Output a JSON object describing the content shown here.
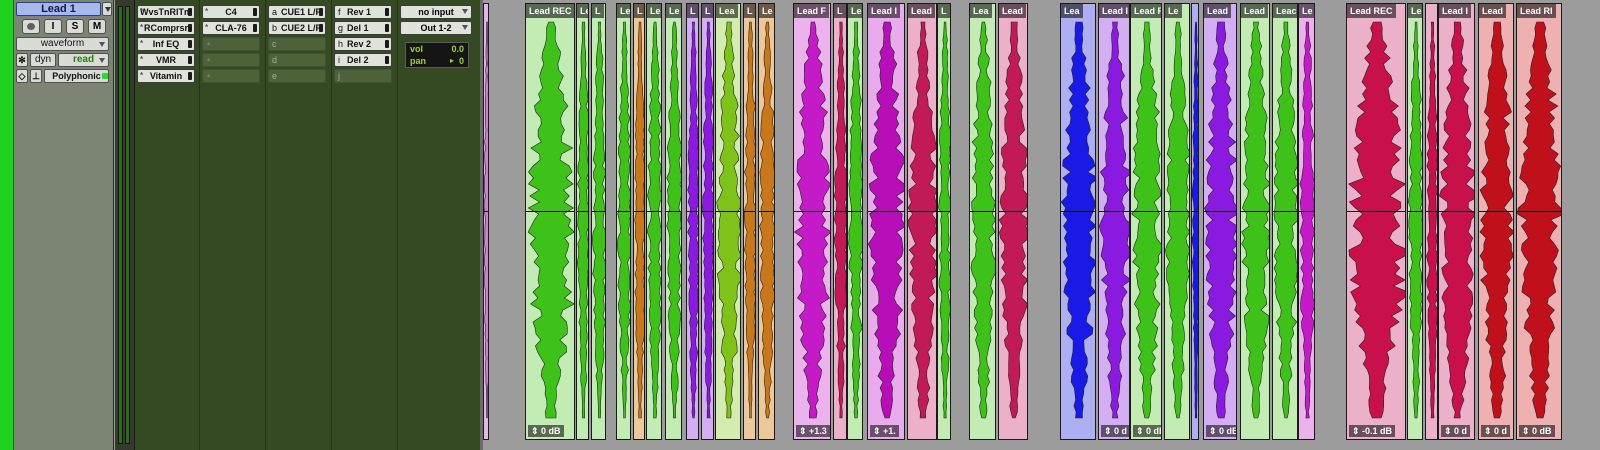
{
  "track": {
    "name": "Lead 1",
    "record_label": "",
    "input_monitor_label": "I",
    "solo_label": "S",
    "mute_label": "M",
    "view": "waveform",
    "dyn_label": "dyn",
    "automation_mode": "read",
    "elastic_audio": "Polyphonic",
    "color": "#1fd21f"
  },
  "inserts_a_e": [
    "WvsTnRlTm",
    "RComprsr",
    "Inf EQ",
    "VMR",
    "Vitamin"
  ],
  "inserts_f_j": [
    "C4",
    "CLA-76",
    "",
    "",
    ""
  ],
  "sends_a_e": [
    {
      "letter": "a",
      "name": "CUE1 L/R"
    },
    {
      "letter": "b",
      "name": "CUE2 L/R"
    },
    {
      "letter": "c",
      "name": ""
    },
    {
      "letter": "d",
      "name": ""
    },
    {
      "letter": "e",
      "name": ""
    }
  ],
  "sends_f_j": [
    {
      "letter": "f",
      "name": "Rev 1"
    },
    {
      "letter": "g",
      "name": "Del 1"
    },
    {
      "letter": "h",
      "name": "Rev 2"
    },
    {
      "letter": "i",
      "name": "Del 2"
    },
    {
      "letter": "j",
      "name": ""
    }
  ],
  "io": {
    "input": "no input",
    "output": "Out 1-2",
    "vol_label": "vol",
    "vol_value": "0.0",
    "pan_label": "pan",
    "pan_value": "0"
  },
  "clips": [
    {
      "label": "",
      "gain": "",
      "color": "#d080d0",
      "bg": "#e3b7e3"
    },
    {
      "label": "Lead REC",
      "gain": "0 dB",
      "color": "#3ec21a",
      "bg": "#c2ecb4"
    },
    {
      "label": "Le",
      "gain": "",
      "color": "#3ec21a",
      "bg": "#c2ecb4"
    },
    {
      "label": "L",
      "gain": "",
      "color": "#3ec21a",
      "bg": "#c2ecb4"
    },
    {
      "label": "Le",
      "gain": "",
      "color": "#3ec21a",
      "bg": "#c2ecb4"
    },
    {
      "label": "L",
      "gain": "",
      "color": "#c8781a",
      "bg": "#ecc89a"
    },
    {
      "label": "Le",
      "gain": "",
      "color": "#3ec21a",
      "bg": "#c2ecb4"
    },
    {
      "label": "Le",
      "gain": "",
      "color": "#3ec21a",
      "bg": "#c2ecb4"
    },
    {
      "label": "L",
      "gain": "",
      "color": "#8a1ae0",
      "bg": "#d4aef2"
    },
    {
      "label": "L",
      "gain": "",
      "color": "#8a1ae0",
      "bg": "#d4aef2"
    },
    {
      "label": "Lea",
      "gain": "",
      "color": "#7ec21a",
      "bg": "#d4ecb0"
    },
    {
      "label": "L",
      "gain": "",
      "color": "#c8781a",
      "bg": "#ecc89a"
    },
    {
      "label": "Le",
      "gain": "",
      "color": "#c8781a",
      "bg": "#ecc89a"
    },
    {
      "label": "Lead F",
      "gain": "+1.3",
      "color": "#c41ac8",
      "bg": "#ecb2ec"
    },
    {
      "label": "L",
      "gain": "",
      "color": "#c21a55",
      "bg": "#ecb0c8"
    },
    {
      "label": "Le",
      "gain": "",
      "color": "#3ec21a",
      "bg": "#c2ecb4"
    },
    {
      "label": "Lead I",
      "gain": "+1.",
      "color": "#b80eb8",
      "bg": "#e8acec"
    },
    {
      "label": "Lead",
      "gain": "",
      "color": "#c21a55",
      "bg": "#ecb0c8"
    },
    {
      "label": "L",
      "gain": "",
      "color": "#3ec21a",
      "bg": "#c2ecb4"
    },
    {
      "label": "Lea",
      "gain": "",
      "color": "#3ec21a",
      "bg": "#c2ecb4"
    },
    {
      "label": "Lead",
      "gain": "",
      "color": "#c21a55",
      "bg": "#ecb0c8"
    },
    {
      "label": "Lea",
      "gain": "",
      "color": "#1a1ae6",
      "bg": "#aeaef2"
    },
    {
      "label": "Lead I",
      "gain": "0 d",
      "color": "#8a1ae0",
      "bg": "#d4aef2"
    },
    {
      "label": "Lead R",
      "gain": "0 dB",
      "color": "#3ec21a",
      "bg": "#c2ecb4"
    },
    {
      "label": "Le",
      "gain": "",
      "color": "#3ec21a",
      "bg": "#c2ecb4"
    },
    {
      "label": "",
      "gain": "",
      "color": "#1a1ae6",
      "bg": "#aeaef2"
    },
    {
      "label": "Lead",
      "gain": "0 dB",
      "color": "#8a1ae0",
      "bg": "#d4aef2"
    },
    {
      "label": "Lead",
      "gain": "",
      "color": "#3ec21a",
      "bg": "#c2ecb4"
    },
    {
      "label": "Leac",
      "gain": "",
      "color": "#3ec21a",
      "bg": "#c2ecb4"
    },
    {
      "label": "Le",
      "gain": "",
      "color": "#c41ac8",
      "bg": "#ecb2ec"
    },
    {
      "label": "Lead REC",
      "gain": "-0.1 dB",
      "color": "#c8104a",
      "bg": "#ecb0c8"
    },
    {
      "label": "Le",
      "gain": "",
      "color": "#3ec21a",
      "bg": "#c2ecb4"
    },
    {
      "label": "",
      "gain": "",
      "color": "#c8104a",
      "bg": "#ecb0c8"
    },
    {
      "label": "Lead I",
      "gain": "0 d",
      "color": "#c8104a",
      "bg": "#ecb0c8"
    },
    {
      "label": "Lead",
      "gain": "0 d",
      "color": "#c0101c",
      "bg": "#eeb0b0"
    },
    {
      "label": "Lead RI",
      "gain": "0 dB",
      "color": "#c0101c",
      "bg": "#eeb0b0"
    }
  ]
}
